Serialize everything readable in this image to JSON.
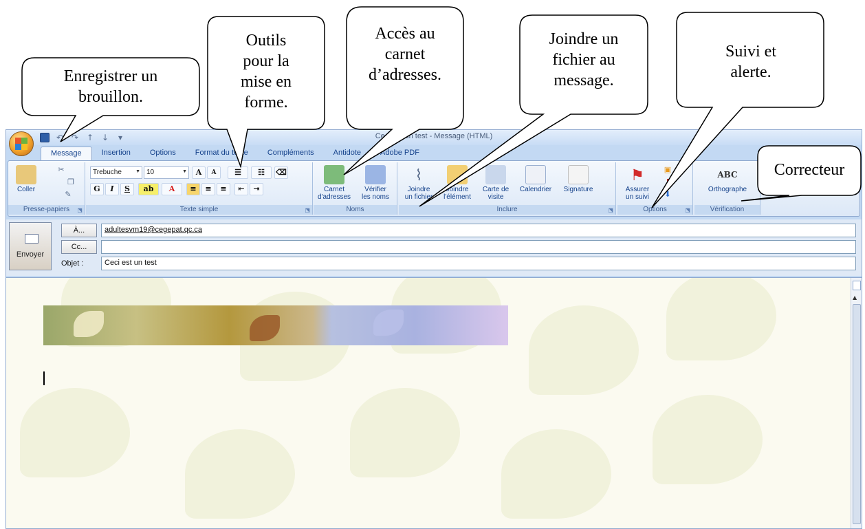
{
  "window": {
    "title": "Ceci est un test - Message (HTML)",
    "tabs": [
      "Message",
      "Insertion",
      "Options",
      "Format du texte",
      "Compléments",
      "Antidote",
      "Adobe PDF"
    ],
    "active_tab": "Message"
  },
  "ribbon": {
    "clipboard": {
      "paste": "Coller",
      "group": "Presse-papiers"
    },
    "font": {
      "name": "Trebuche",
      "size": "10",
      "group": "Texte simple"
    },
    "names": {
      "address_book_1": "Carnet",
      "address_book_2": "d'adresses",
      "check_names_1": "Vérifier",
      "check_names_2": "les noms",
      "group": "Noms"
    },
    "include": {
      "attach_file_1": "Joindre",
      "attach_file_2": "un fichier",
      "attach_item_1": "Joindre",
      "attach_item_2": "l'élément",
      "business_card_1": "Carte de",
      "business_card_2": "visite",
      "calendar": "Calendrier",
      "signature": "Signature",
      "group": "Inclure"
    },
    "options": {
      "follow_up_1": "Assurer",
      "follow_up_2": "un suivi",
      "group": "Options"
    },
    "proofing": {
      "spelling": "Orthographe",
      "group": "Vérification"
    }
  },
  "header": {
    "send": "Envoyer",
    "to_button": "À...",
    "cc_button": "Cc...",
    "subject_label": "Objet :",
    "to_value": "adultesvm19@cegepat.qc.ca",
    "cc_value": "",
    "subject_value": "Ceci est un test"
  },
  "callouts": {
    "draft": "Enregistrer un brouillon.",
    "format_1": "Outils",
    "format_2": "pour la",
    "format_3": "mise en",
    "format_4": "forme.",
    "address_1": "Accès au",
    "address_2": "carnet",
    "address_3": "d’adresses.",
    "attach_1": "Joindre un",
    "attach_2": "fichier au",
    "attach_3": "message.",
    "followup_1": "Suivi et",
    "followup_2": "alerte.",
    "spell": "Correcteur"
  }
}
